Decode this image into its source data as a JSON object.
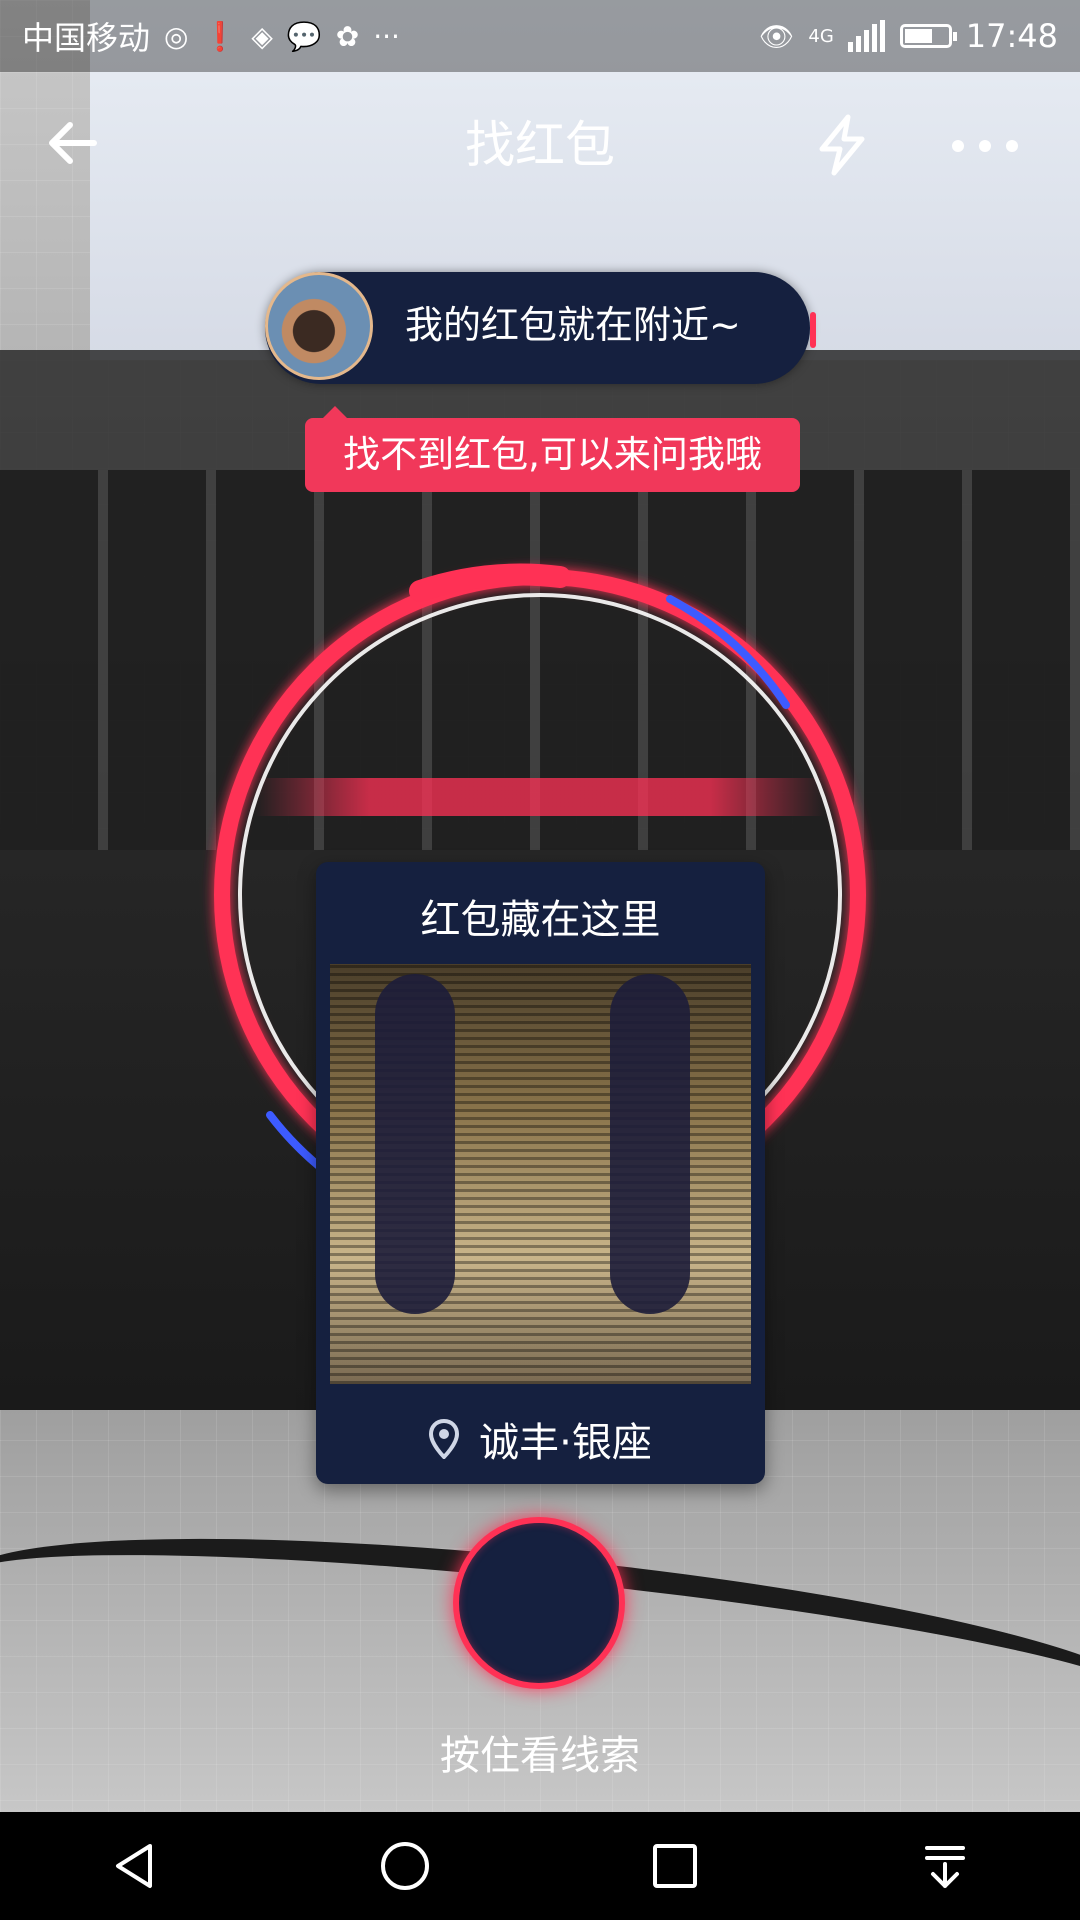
{
  "status_bar": {
    "carrier": "中国移动",
    "left_icons": [
      "hotspot-icon",
      "alert-icon",
      "map-icon",
      "message-icon",
      "huawei-icon"
    ],
    "more": "···",
    "network": "4G",
    "time": "17:48"
  },
  "header": {
    "title": "找红包",
    "back_icon": "arrow-left-icon",
    "flash_icon": "lightning-icon",
    "more_icon": "more-dots-icon"
  },
  "hint": {
    "bubble_text": "我的红包就在附近~",
    "tooltip_text": "找不到红包,可以来问我哦"
  },
  "clue_card": {
    "title": "红包藏在这里",
    "location": "诚丰·银座",
    "location_icon": "location-pin-icon"
  },
  "hold_button": {
    "label": "按住看线索"
  },
  "nav_bar": {
    "buttons": [
      "back-triangle-icon",
      "home-circle-icon",
      "recents-square-icon",
      "notification-down-icon"
    ]
  },
  "colors": {
    "accent_red": "#ff3155",
    "navy": "#15203f",
    "tooltip_red": "#f1385a"
  }
}
